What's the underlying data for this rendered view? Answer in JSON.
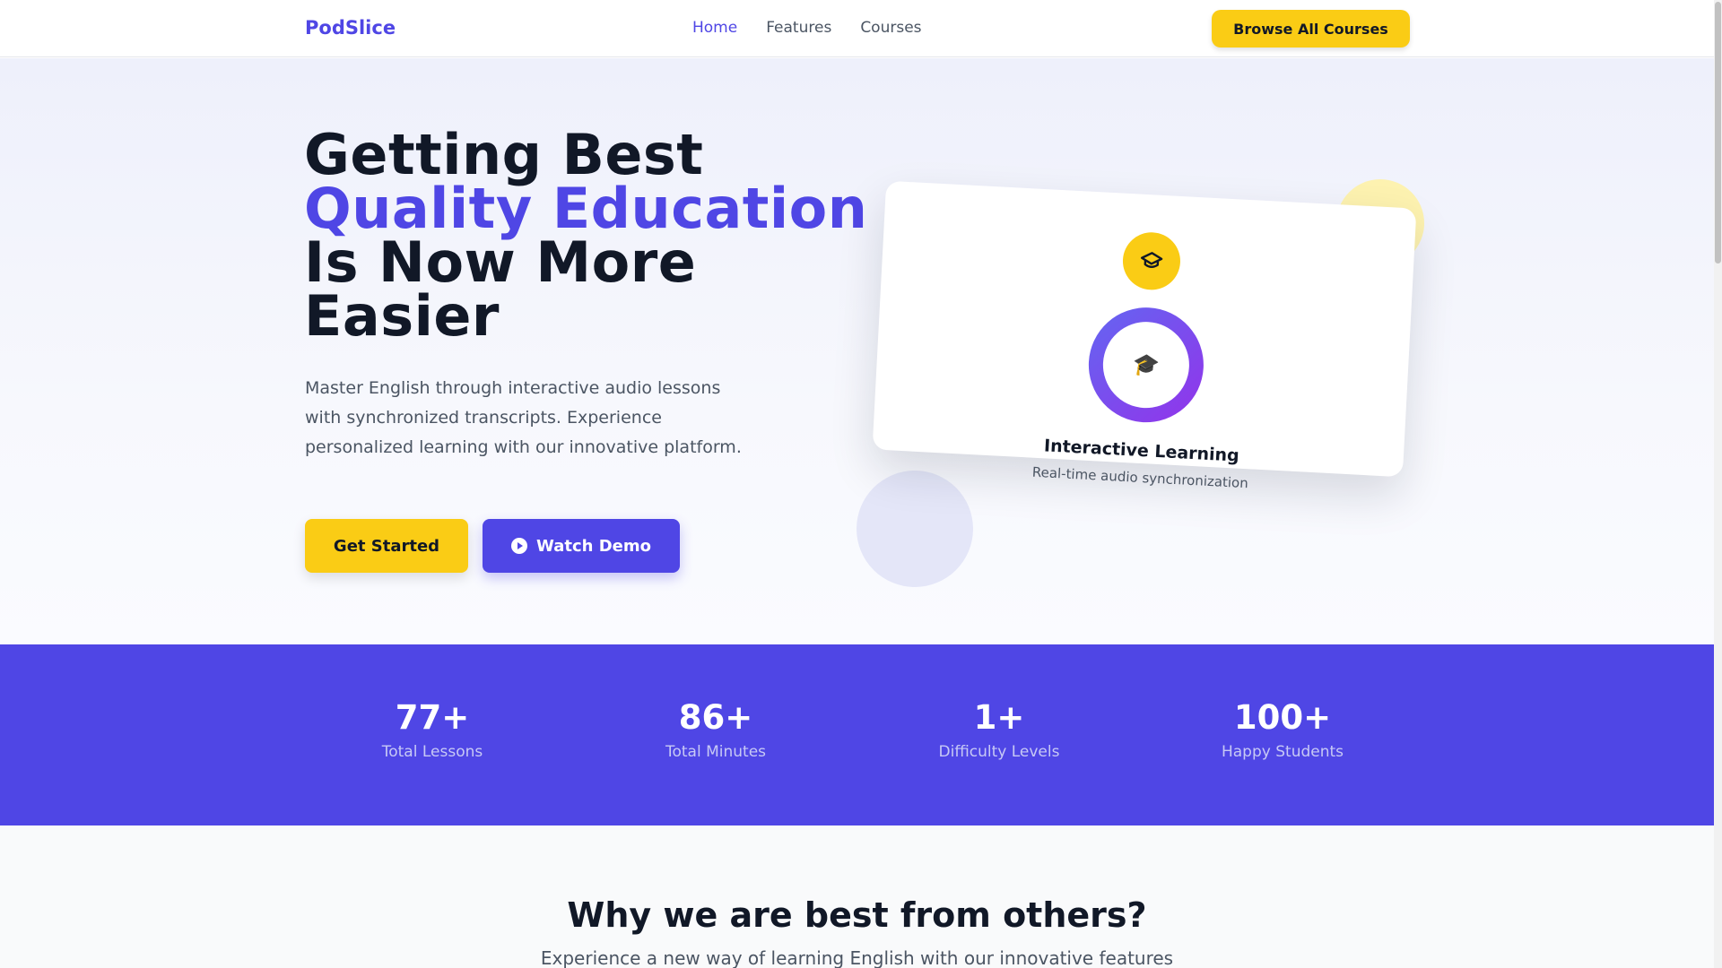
{
  "nav": {
    "brand": "PodSlice",
    "links": [
      "Home",
      "Features",
      "Courses"
    ],
    "cta": "Browse All Courses"
  },
  "hero": {
    "title_line1": "Getting Best",
    "title_accent": "Quality Education",
    "title_line3": "Is Now More Easier",
    "description": "Master English through interactive audio lessons with synchronized transcripts. Experience personalized learning with our innovative platform.",
    "primary_button": "Get Started",
    "secondary_button": "Watch Demo"
  },
  "card": {
    "badge_icon": "graduation-cap-icon",
    "ring_emoji": "🎓",
    "title": "Interactive Learning",
    "subtitle": "Real-time audio synchronization"
  },
  "stats": [
    {
      "value": "77+",
      "label": "Total Lessons"
    },
    {
      "value": "86+",
      "label": "Total Minutes"
    },
    {
      "value": "1+",
      "label": "Difficulty Levels"
    },
    {
      "value": "100+",
      "label": "Happy Students"
    }
  ],
  "why": {
    "title": "Why we are best from others?",
    "subtitle": "Experience a new way of learning English with our innovative features"
  },
  "colors": {
    "brand": "#4f46e5",
    "accent_yellow": "#facc15",
    "text_dark": "#111827",
    "text_muted": "#4b5563"
  }
}
